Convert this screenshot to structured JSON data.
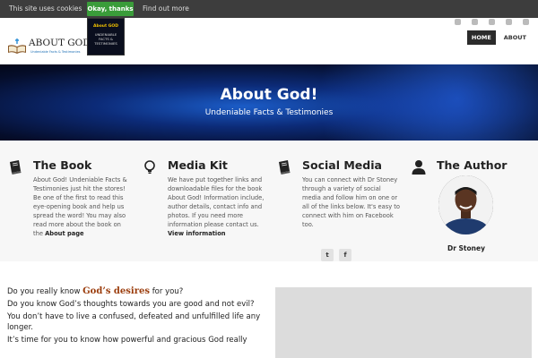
{
  "cookie_bar": {
    "message": "This site uses cookies",
    "ok_label": "Okay, thanks",
    "more_label": "Find out more"
  },
  "header": {
    "logo_name": "ABOUT GOD",
    "logo_tagline": "Undeniable Facts & Testimonies",
    "book_thumb_title": "About GOD",
    "book_thumb_subtitle": "UNDENIABLE FACTS & TESTIMONIES",
    "nav": [
      {
        "label": "HOME",
        "active": true
      },
      {
        "label": "ABOUT",
        "active": false
      }
    ],
    "social_icons": [
      "twitter-icon",
      "pinterest-icon",
      "bookmark-icon",
      "mail-icon",
      "facebook-icon"
    ]
  },
  "hero": {
    "title": "About God!",
    "subtitle": "Undeniable Facts & Testimonies"
  },
  "features": {
    "book": {
      "icon": "book-icon",
      "title": "The Book",
      "text": "About God! Undeniable Facts & Testimonies just hit the stores! Be one of the first to read this eye-opening book and help us spread the word! You may also read more about the book on the",
      "link": "About page"
    },
    "media": {
      "icon": "lightbulb-icon",
      "title": "Media Kit",
      "text": "We have put together links and downloadable files for the book About God! Information include, author details, contact info and photos. If you need more information please contact us.",
      "link": "View information"
    },
    "social": {
      "icon": "book-icon",
      "title": "Social Media",
      "text": "You can connect with Dr Stoney through a variety of social media and follow him on one or all of the links below. It's easy to connect with him on Facebook too.",
      "buttons": [
        "t",
        "f"
      ]
    },
    "author": {
      "icon": "user-icon",
      "title": "The Author",
      "name": "Dr Stoney"
    }
  },
  "content": {
    "line1_before": "Do you really know",
    "line1_emph": "God’s desires",
    "line1_after": "for you?",
    "line2": "Do you know God’s thoughts towards you are good and not evil?",
    "line3": "You don’t have to live a confused, defeated and unfulfilled life any longer.",
    "line4": "It’s time for you to know how powerful and gracious God really"
  },
  "colors": {
    "cookie_ok": "#3a9c3a",
    "hero_accent": "#1b5cc7",
    "emphasis": "#9b3d0d"
  }
}
